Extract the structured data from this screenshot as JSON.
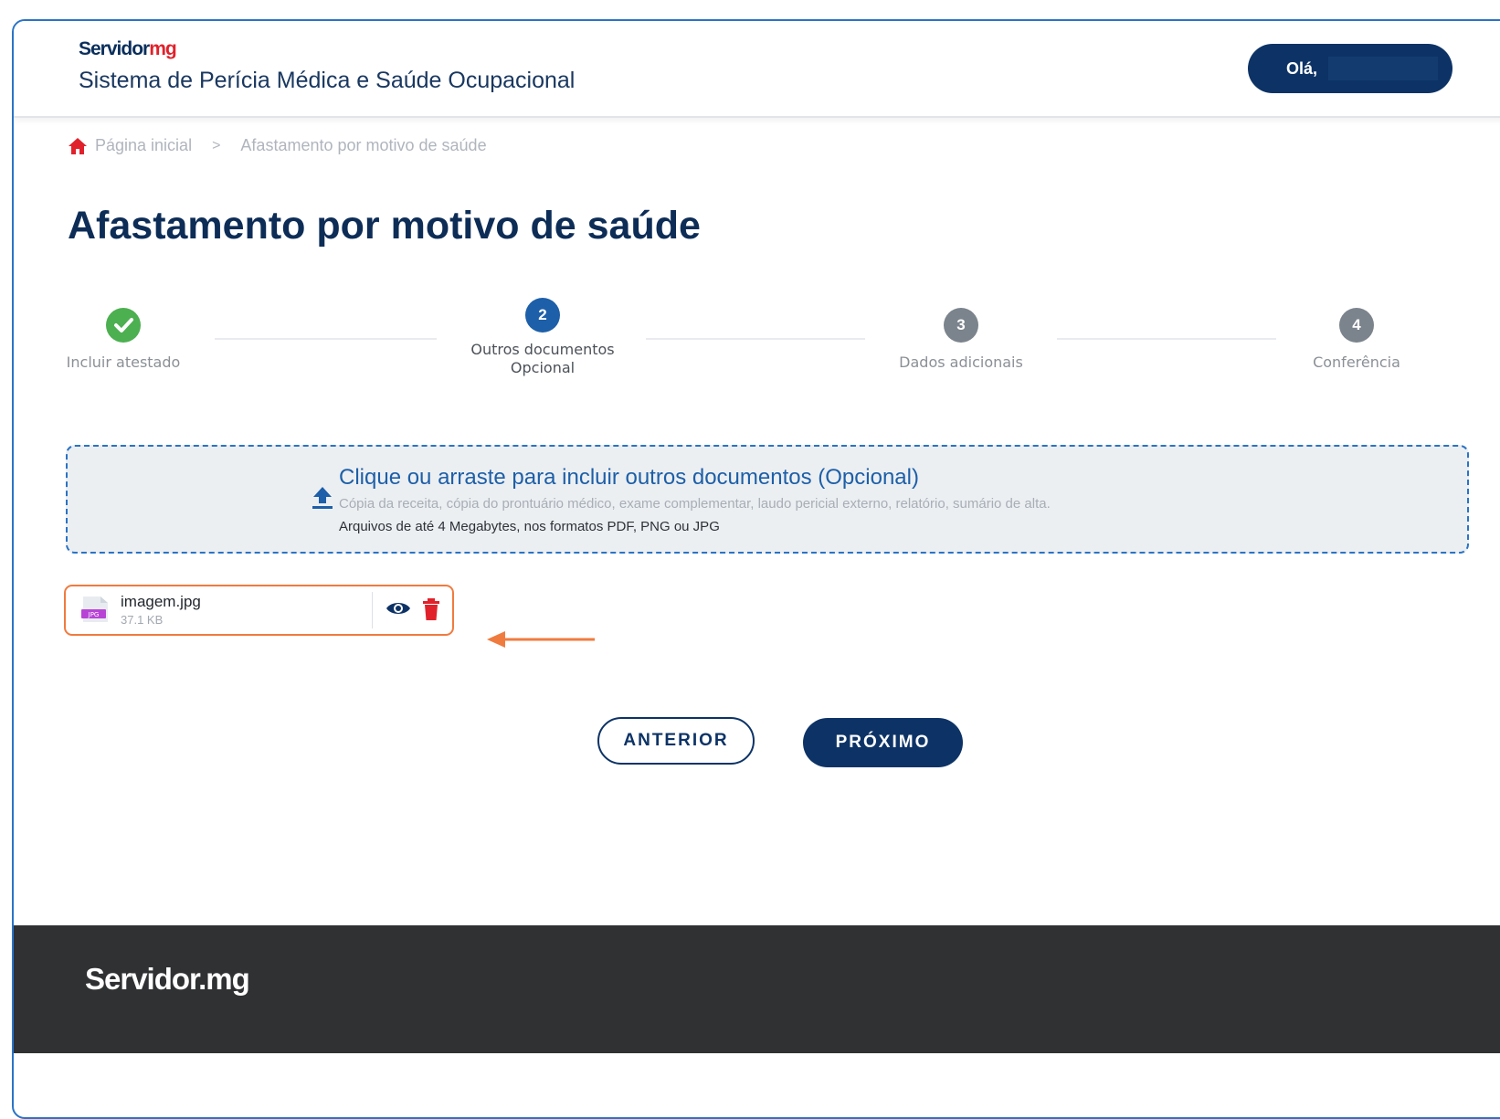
{
  "header": {
    "logo_part1": "Servidor",
    "logo_part2": "mg",
    "system_title": "Sistema de Perícia Médica e Saúde Ocupacional",
    "user_greeting": "Olá,"
  },
  "breadcrumb": {
    "home": "Página inicial",
    "separator": ">",
    "current": "Afastamento por motivo de saúde"
  },
  "page_title": "Afastamento por motivo de saúde",
  "stepper": {
    "steps": [
      {
        "number": "",
        "label": "Incluir atestado",
        "sublabel": "",
        "status": "completed"
      },
      {
        "number": "2",
        "label": "Outros documentos",
        "sublabel": "Opcional",
        "status": "active"
      },
      {
        "number": "3",
        "label": "Dados adicionais",
        "sublabel": "",
        "status": "pending"
      },
      {
        "number": "4",
        "label": "Conferência",
        "sublabel": "",
        "status": "pending"
      }
    ]
  },
  "dropzone": {
    "title": "Clique ou arraste para incluir outros documentos (Opcional)",
    "description": "Cópia da receita, cópia do prontuário médico, exame complementar, laudo pericial externo, relatório, sumário de alta.",
    "limits": "Arquivos de até 4 Megabytes, nos formatos PDF, PNG ou JPG",
    "icon": "upload-icon"
  },
  "file": {
    "name": "imagem.jpg",
    "size": "37.1 KB",
    "type_badge": "JPG"
  },
  "buttons": {
    "previous": "ANTERIOR",
    "next": "PRÓXIMO"
  },
  "footer": {
    "logo": "Servidor.mg"
  },
  "colors": {
    "primary": "#0d3366",
    "accent_blue": "#2a73c6",
    "success": "#4caf50",
    "danger": "#e0212b",
    "highlight": "#f07b3f",
    "footer_bg": "#2f3133"
  }
}
